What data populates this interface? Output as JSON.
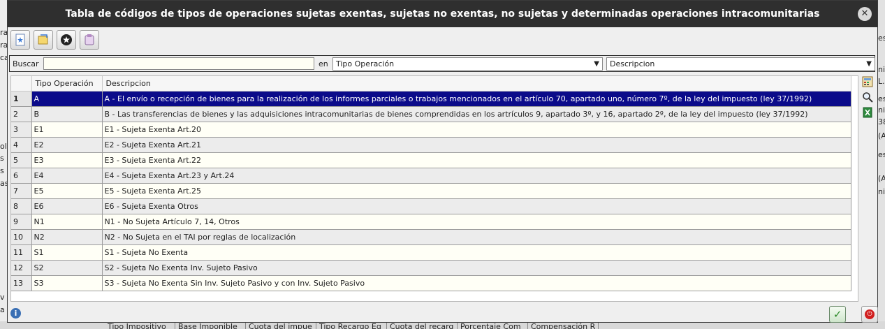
{
  "dialog": {
    "title": "Tabla de códigos de tipos de operaciones sujetas exentas, sujetas no exentas, no sujetas y determinadas operaciones intracomunitarias",
    "close_glyph": "✕"
  },
  "search": {
    "label": "Buscar",
    "value": "",
    "in_label": "en",
    "field_selected": "Tipo Operación",
    "column_selected": "Descripcion"
  },
  "grid": {
    "columns": [
      "Tipo Operación",
      "Descripcion"
    ],
    "selected_row": 1,
    "rows": [
      {
        "n": "1",
        "tipo": "A",
        "desc": "A - El envío o recepción de bienes para la realización de los informes parciales o trabajos mencionados en el artículo 70, apartado uno, número 7º, de la ley del impuesto (ley 37/1992)"
      },
      {
        "n": "2",
        "tipo": "B",
        "desc": "B - Las transferencias de bienes y las adquisiciones intracomunitarias de bienes comprendidas en los artrículos 9, apartado 3º, y 16, apartado 2º, de la ley del impuesto (ley 37/1992)"
      },
      {
        "n": "3",
        "tipo": "E1",
        "desc": "E1 - Sujeta Exenta Art.20"
      },
      {
        "n": "4",
        "tipo": "E2",
        "desc": "E2 - Sujeta Exenta Art.21"
      },
      {
        "n": "5",
        "tipo": "E3",
        "desc": "E3 - Sujeta Exenta Art.22"
      },
      {
        "n": "6",
        "tipo": "E4",
        "desc": "E4 - Sujeta Exenta Art.23 y Art.24"
      },
      {
        "n": "7",
        "tipo": "E5",
        "desc": "E5 - Sujeta Exenta Art.25"
      },
      {
        "n": "8",
        "tipo": "E6",
        "desc": "E6 - Sujeta Exenta Otros"
      },
      {
        "n": "9",
        "tipo": "N1",
        "desc": "N1 - No Sujeta Artículo 7, 14, Otros"
      },
      {
        "n": "10",
        "tipo": "N2",
        "desc": "N2 - No Sujeta en el TAI por reglas de localización"
      },
      {
        "n": "11",
        "tipo": "S1",
        "desc": "S1 - Sujeta No Exenta"
      },
      {
        "n": "12",
        "tipo": "S2",
        "desc": "S2 - Sujeta No Exenta Inv. Sujeto Pasivo"
      },
      {
        "n": "13",
        "tipo": "S3",
        "desc": "S3 - Sujeta No Exenta Sin Inv. Sujeto Pasivo y con Inv. Sujeto Pasivo"
      }
    ]
  },
  "icons": {
    "toolbar": [
      "new-record-icon",
      "edit-record-icon",
      "filter-icon",
      "export-icon"
    ],
    "sidebar": [
      "calculator-icon",
      "search-icon",
      "excel-icon"
    ],
    "footer": [
      "info-icon",
      "accept-icon",
      "cancel-icon"
    ]
  },
  "background": {
    "left_fragments": [
      "ra",
      "ca",
      "ole",
      "s",
      "s",
      "as",
      "v",
      "a",
      "ra"
    ],
    "right_fragments": [
      "es",
      "ni",
      "L.",
      "es",
      "ni",
      "38",
      "(A",
      "es",
      "(A",
      "ni"
    ],
    "bottom_columns": [
      "Tipo Impositivo",
      "Base Imponible",
      "Cuota del impue",
      "Tipo Recargo Eq",
      "Cuota del recarg",
      "Porcentaje Com",
      "Compensación R"
    ]
  },
  "colors": {
    "selection": "#0b0b8a",
    "titlebar": "#2f2f2f"
  }
}
